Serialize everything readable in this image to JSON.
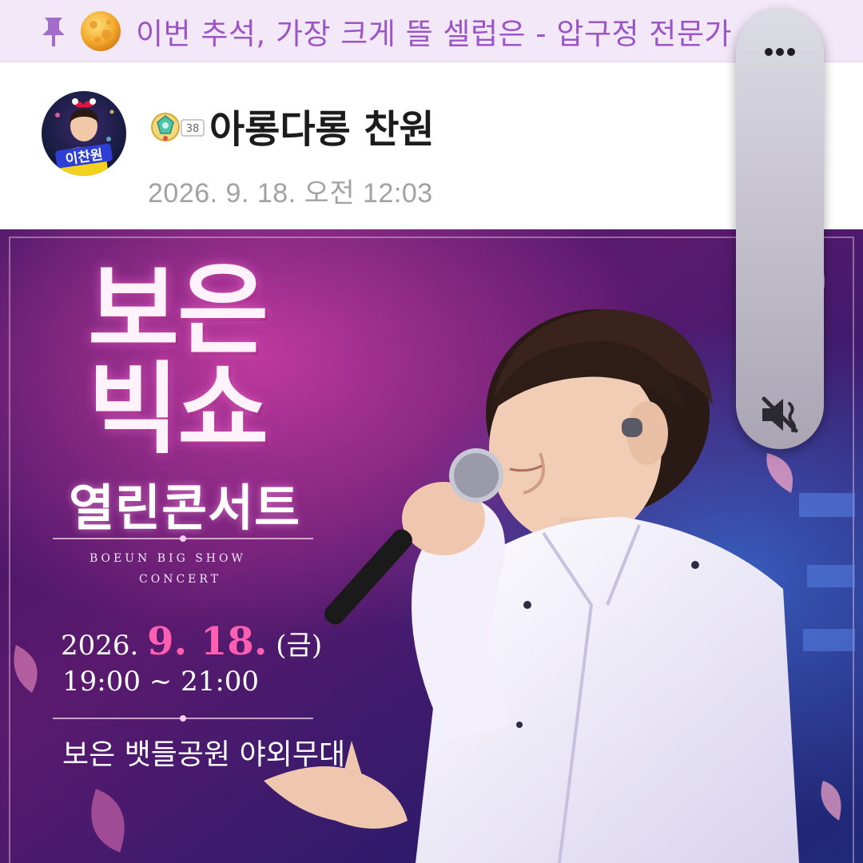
{
  "notice": {
    "text": "이번 추석, 가장 크게 뜰 셀럽은 - 압구정 전문가",
    "pin_icon": "pin-icon",
    "emoji_icon": "full-moon-icon",
    "accent_color": "#9c55c6"
  },
  "post": {
    "author_name": "아롱다롱 찬원",
    "level_badge": "38",
    "timestamp": "2026. 9. 18. 오전 12:03",
    "avatar_caption": "이찬원"
  },
  "poster": {
    "title_line1": "보은",
    "title_line2": "빅쇼",
    "subtitle": "열린콘서트",
    "english_line1": "BOEUN BIG SHOW",
    "english_line2": "CONCERT",
    "date_year": "2026.",
    "date_main": "9. 18.",
    "date_day": "(금)",
    "time": "19:00 ~ 21:00",
    "venue": "보은 뱃들공원 야외무대"
  },
  "float_control": {
    "more_icon": "more-dots-icon",
    "mute_icon": "speaker-muted-icon"
  }
}
